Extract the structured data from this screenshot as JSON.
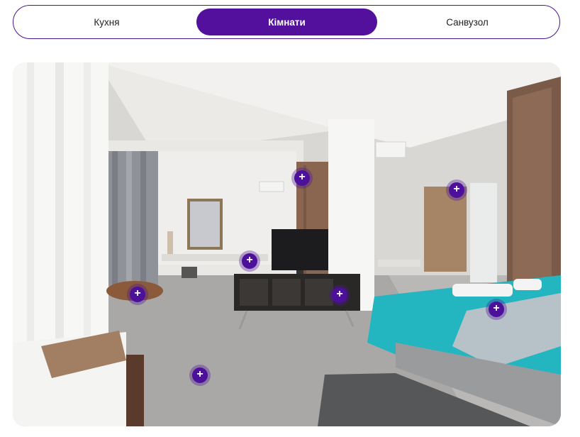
{
  "tabs": [
    {
      "label": "Кухня",
      "active": false
    },
    {
      "label": "Кімнати",
      "active": true
    },
    {
      "label": "Санвузол",
      "active": false
    }
  ],
  "hotspot_icon": "plus-icon",
  "hotspot_glyph": "+",
  "colors": {
    "accent": "#52109c",
    "accent_border": "#4b1591"
  }
}
